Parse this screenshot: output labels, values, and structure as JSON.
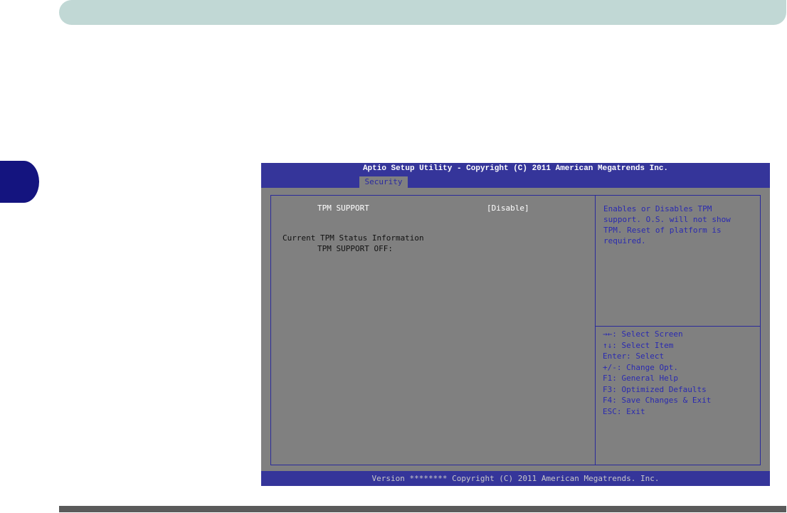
{
  "bios": {
    "title": "Aptio Setup Utility - Copyright (C) 2011 American Megatrends Inc.",
    "tab": "Security",
    "items": {
      "tpm_support_label": "TPM SUPPORT",
      "tpm_support_value": "[Disable]",
      "status_heading": "Current TPM Status Information",
      "status_line": "TPM SUPPORT OFF:"
    },
    "help": "Enables or Disables TPM support. O.S. will not show TPM. Reset of platform is required.",
    "keys": [
      "→←: Select Screen",
      "↑↓: Select Item",
      "Enter: Select",
      "+/-: Change Opt.",
      "F1: General Help",
      "F3: Optimized Defaults",
      "F4: Save Changes & Exit",
      "ESC: Exit"
    ],
    "footer": "Version ******** Copyright (C) 2011 American Megatrends. Inc."
  }
}
